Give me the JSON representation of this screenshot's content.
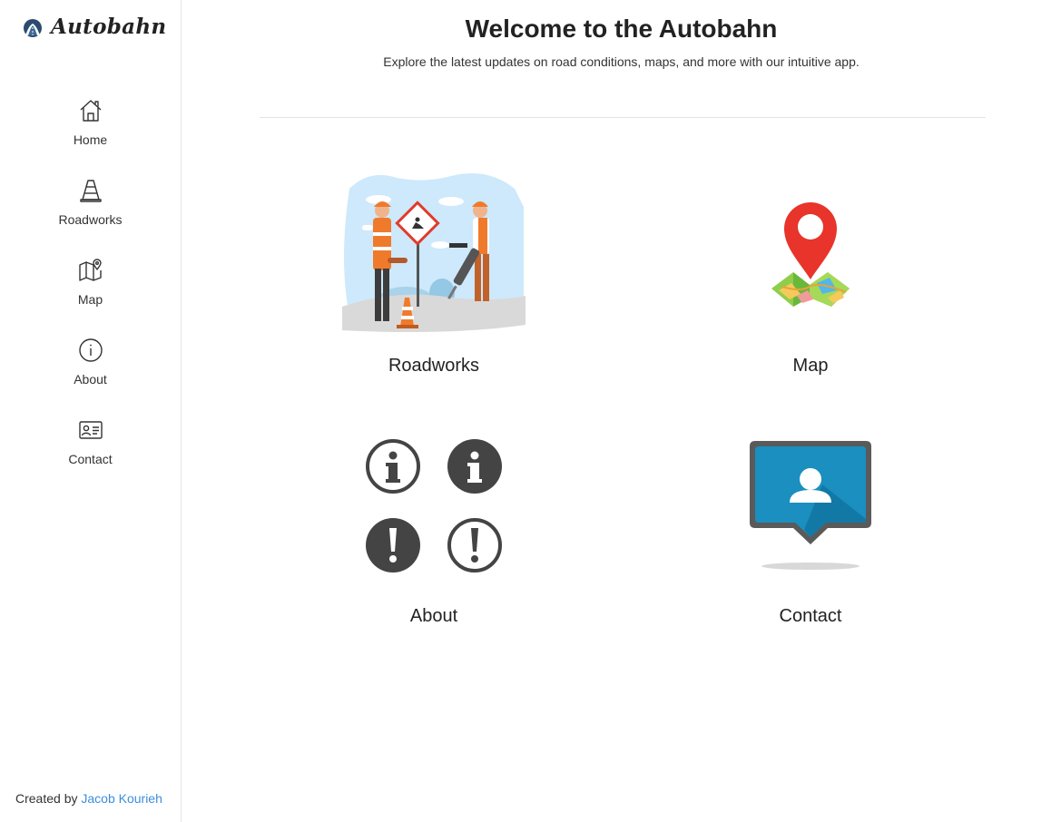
{
  "brand": {
    "name": "Autobahn",
    "logo_icon": "autobahn-road-logo-icon"
  },
  "sidebar": {
    "items": [
      {
        "label": "Home",
        "icon": "home-icon"
      },
      {
        "label": "Roadworks",
        "icon": "traffic-cone-icon"
      },
      {
        "label": "Map",
        "icon": "map-pin-icon"
      },
      {
        "label": "About",
        "icon": "info-icon"
      },
      {
        "label": "Contact",
        "icon": "contact-card-icon"
      }
    ]
  },
  "footer": {
    "prefix": "Created by",
    "author": "Jacob Kourieh",
    "link_color": "#3b8fdc"
  },
  "main": {
    "title": "Welcome to the Autobahn",
    "subtitle": "Explore the latest updates on road conditions, maps, and more with our intuitive app.",
    "cards": [
      {
        "label": "Roadworks",
        "image": "roadworks-illustration"
      },
      {
        "label": "Map",
        "image": "map-pin-illustration"
      },
      {
        "label": "About",
        "image": "info-alert-icons-illustration"
      },
      {
        "label": "Contact",
        "image": "contact-speech-bubble-illustration"
      }
    ]
  },
  "colors": {
    "accent_blue": "#1a8fc0",
    "pin_red": "#e8342a",
    "icon_dark": "#444444"
  }
}
